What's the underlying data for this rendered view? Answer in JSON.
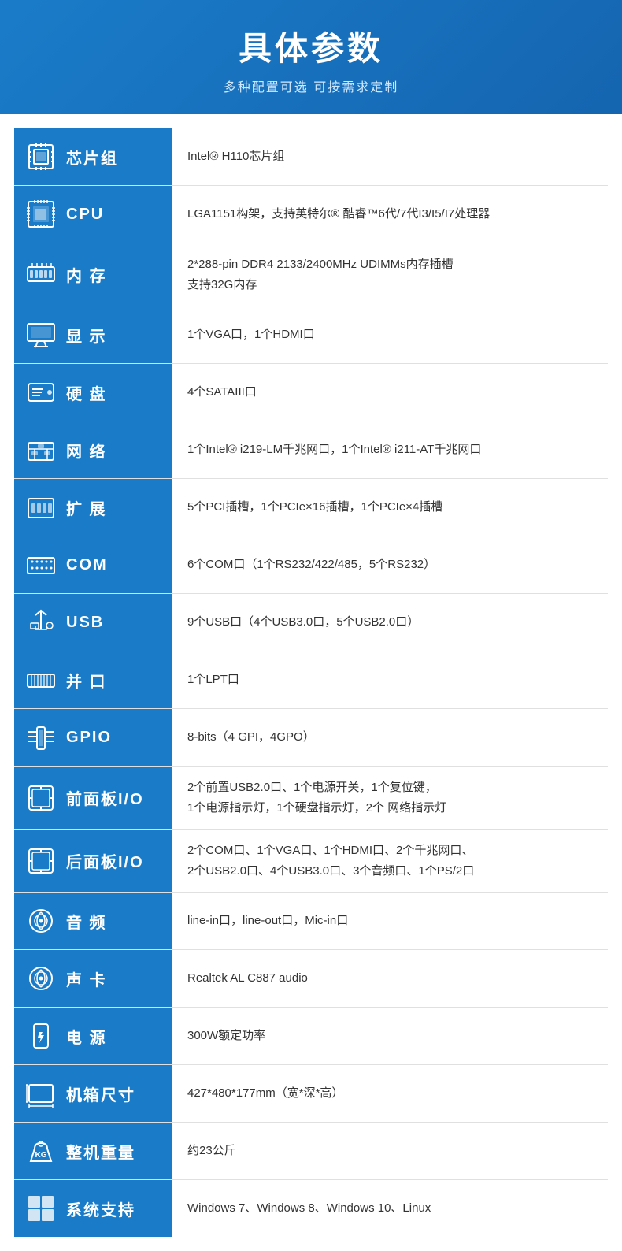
{
  "header": {
    "title": "具体参数",
    "subtitle": "多种配置可选 可按需求定制"
  },
  "rows": [
    {
      "key": "chipset",
      "icon": "chipset",
      "label": "芯片组",
      "value": "Intel® H110芯片组"
    },
    {
      "key": "cpu",
      "icon": "cpu",
      "label": "CPU",
      "value": "LGA1151构架，支持英特尔® 酷睿™6代/7代I3/I5/I7处理器"
    },
    {
      "key": "memory",
      "icon": "memory",
      "label": "内 存",
      "value": "2*288-pin DDR4 2133/2400MHz UDIMMs内存插槽\n支持32G内存"
    },
    {
      "key": "display",
      "icon": "display",
      "label": "显 示",
      "value": "1个VGA口，1个HDMI口"
    },
    {
      "key": "hdd",
      "icon": "hdd",
      "label": "硬 盘",
      "value": "4个SATAIII口"
    },
    {
      "key": "network",
      "icon": "network",
      "label": "网 络",
      "value": "1个Intel® i219-LM千兆网口，1个Intel® i211-AT千兆网口"
    },
    {
      "key": "expansion",
      "icon": "expansion",
      "label": "扩 展",
      "value": "5个PCI插槽，1个PCIe×16插槽，1个PCIe×4插槽"
    },
    {
      "key": "com",
      "icon": "com",
      "label": "COM",
      "value": "6个COM口（1个RS232/422/485，5个RS232）"
    },
    {
      "key": "usb",
      "icon": "usb",
      "label": "USB",
      "value": "9个USB口（4个USB3.0口，5个USB2.0口）"
    },
    {
      "key": "parallel",
      "icon": "parallel",
      "label": "并 口",
      "value": "1个LPT口"
    },
    {
      "key": "gpio",
      "icon": "gpio",
      "label": "GPIO",
      "value": "8-bits（4 GPI，4GPO）"
    },
    {
      "key": "front-panel",
      "icon": "panel",
      "label": "前面板I/O",
      "value": "2个前置USB2.0口、1个电源开关，1个复位键，\n1个电源指示灯，1个硬盘指示灯，2个 网络指示灯"
    },
    {
      "key": "rear-panel",
      "icon": "panel",
      "label": "后面板I/O",
      "value": "2个COM口、1个VGA口、1个HDMI口、2个千兆网口、\n2个USB2.0口、4个USB3.0口、3个音频口、1个PS/2口"
    },
    {
      "key": "audio",
      "icon": "audio",
      "label": "音 频",
      "value": "line-in口，line-out口，Mic-in口"
    },
    {
      "key": "soundcard",
      "icon": "audio",
      "label": "声 卡",
      "value": "Realtek AL C887 audio"
    },
    {
      "key": "power",
      "icon": "power",
      "label": "电 源",
      "value": "300W额定功率"
    },
    {
      "key": "dimensions",
      "icon": "dimensions",
      "label": "机箱尺寸",
      "value": "427*480*177mm（宽*深*高）"
    },
    {
      "key": "weight",
      "icon": "weight",
      "label": "整机重量",
      "value": "约23公斤"
    },
    {
      "key": "os",
      "icon": "os",
      "label": "系统支持",
      "value": "Windows 7、Windows 8、Windows 10、Linux"
    }
  ]
}
